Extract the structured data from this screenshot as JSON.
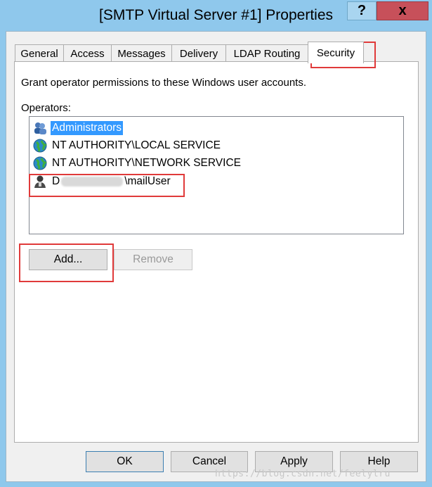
{
  "window": {
    "title": "[SMTP Virtual Server #1] Properties",
    "help_symbol": "?",
    "close_symbol": "x"
  },
  "tabs": [
    {
      "label": "General"
    },
    {
      "label": "Access"
    },
    {
      "label": "Messages"
    },
    {
      "label": "Delivery"
    },
    {
      "label": "LDAP Routing"
    },
    {
      "label": "Security",
      "active": true
    }
  ],
  "security": {
    "description": "Grant operator permissions to these Windows user accounts.",
    "operators_label": "Operators:",
    "operators": [
      {
        "icon": "group-icon",
        "name": "Administrators",
        "selected": true
      },
      {
        "icon": "globe-icon",
        "name": "NT AUTHORITY\\LOCAL SERVICE"
      },
      {
        "icon": "globe-icon",
        "name": "NT AUTHORITY\\NETWORK SERVICE"
      },
      {
        "icon": "user-icon",
        "name_prefix": "D",
        "name_suffix": "\\mailUser"
      }
    ],
    "add_label": "Add...",
    "remove_label": "Remove"
  },
  "footer": {
    "ok_label": "OK",
    "cancel_label": "Cancel",
    "apply_label": "Apply",
    "help_label": "Help"
  },
  "watermark": "https://blog.csdn.net/feelylru",
  "colors": {
    "selection": "#3399ff",
    "highlight_box": "#e03a3a",
    "title_bar": "#8fc8ec"
  }
}
